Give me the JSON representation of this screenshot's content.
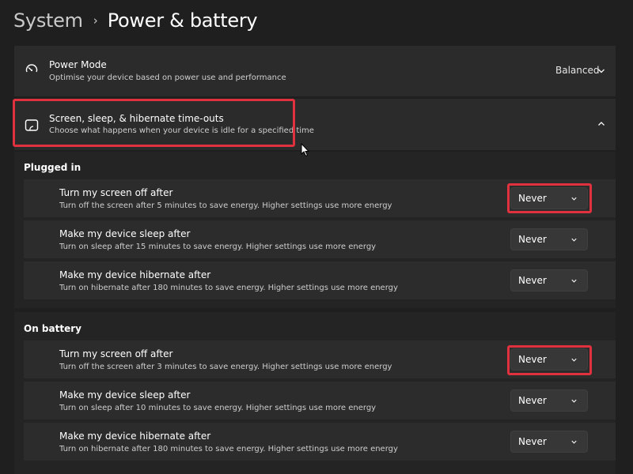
{
  "breadcrumb": {
    "parent": "System",
    "separator": "›",
    "current": "Power & battery"
  },
  "power_mode": {
    "title": "Power Mode",
    "subtitle": "Optimise your device based on power use and performance",
    "value": "Balanced",
    "icon": "power-mode-icon"
  },
  "timeouts": {
    "title": "Screen, sleep, & hibernate time-outs",
    "subtitle": "Choose what happens when your device is idle for a specified time",
    "icon": "screen-sleep-icon",
    "expanded": true
  },
  "plugged_in": {
    "label": "Plugged in",
    "rows": [
      {
        "title": "Turn my screen off after",
        "subtitle": "Turn off the screen after 5 minutes to save energy. Higher settings use more energy",
        "value": "Never"
      },
      {
        "title": "Make my device sleep after",
        "subtitle": "Turn on sleep after 15 minutes to save energy. Higher settings use more energy",
        "value": "Never"
      },
      {
        "title": "Make my device hibernate after",
        "subtitle": "Turn on hibernate after 180 minutes to save energy. Higher settings use more energy",
        "value": "Never"
      }
    ]
  },
  "on_battery": {
    "label": "On battery",
    "rows": [
      {
        "title": "Turn my screen off after",
        "subtitle": "Turn off the screen after 3 minutes to save energy. Higher settings use more energy",
        "value": "Never"
      },
      {
        "title": "Make my device sleep after",
        "subtitle": "Turn on sleep after 10 minutes to save energy. Higher settings use more energy",
        "value": "Never"
      },
      {
        "title": "Make my device hibernate after",
        "subtitle": "Turn on hibernate after 180 minutes to save energy. Higher settings use more energy",
        "value": "Never"
      }
    ]
  },
  "colors": {
    "highlight": "#e0323e",
    "card_bg": "#2b2b2b",
    "page_bg": "#1f1f1f"
  }
}
